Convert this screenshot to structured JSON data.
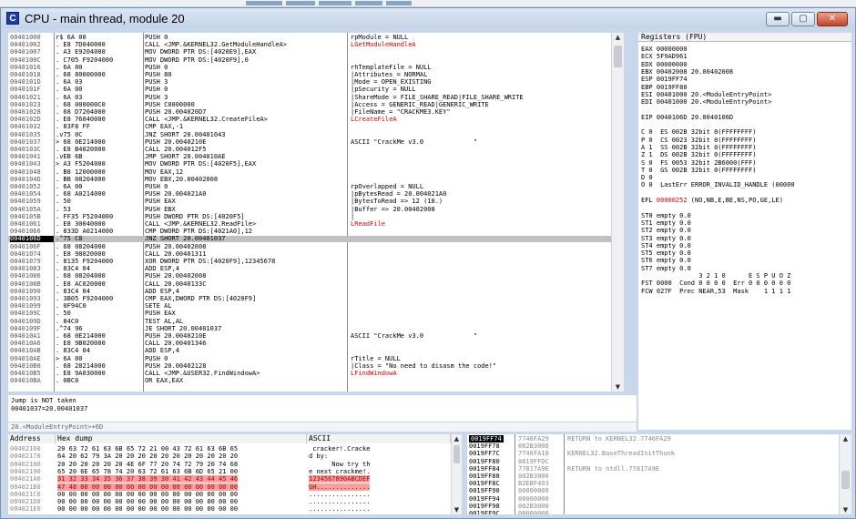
{
  "window": {
    "icon_letter": "C",
    "title": "CPU - main thread, module 20",
    "min_label": "▬",
    "max_label": "▢",
    "close_label": "✕"
  },
  "cpu": {
    "rows": [
      {
        "addr": "00401000",
        "hex": "r$ 6A 00",
        "dis": "PUSH 0",
        "cmt": "rpModule = NULL",
        "cmt_red": false
      },
      {
        "addr": "00401002",
        "hex": ". E8 7D040000",
        "dis": "CALL <JMP.&KERNEL32.GetModuleHandleA>",
        "cmt": "LGetModuleHandleA",
        "cmt_red": true
      },
      {
        "addr": "00401007",
        "hex": ". A3 E9204000",
        "dis": "MOV DWORD PTR DS:[4020E9],EAX",
        "cmt": "",
        "cmt_red": false
      },
      {
        "addr": "0040100C",
        "hex": ". C705 F9204000",
        "dis": "MOV DWORD PTR DS:[4020F9],0",
        "cmt": "",
        "cmt_red": false
      },
      {
        "addr": "00401016",
        "hex": ". 6A 00",
        "dis": "PUSH 0",
        "cmt": "rhTemplateFile = NULL",
        "cmt_red": false
      },
      {
        "addr": "00401018",
        "hex": ". 68 80000000",
        "dis": "PUSH 80",
        "cmt": "|Attributes = NORMAL",
        "cmt_red": false
      },
      {
        "addr": "0040101D",
        "hex": ". 6A 03",
        "dis": "PUSH 3",
        "cmt": "|Mode = OPEN_EXISTING",
        "cmt_red": false
      },
      {
        "addr": "0040101F",
        "hex": ". 6A 00",
        "dis": "PUSH 0",
        "cmt": "|pSecurity = NULL",
        "cmt_red": false
      },
      {
        "addr": "00401021",
        "hex": ". 6A 03",
        "dis": "PUSH 3",
        "cmt": "|ShareMode = FILE_SHARE_READ|FILE_SHARE_WRITE",
        "cmt_red": false
      },
      {
        "addr": "00401023",
        "hex": ". 68 000000C0",
        "dis": "PUSH C0000000",
        "cmt": "|Access = GENERIC_READ|GENERIC_WRITE",
        "cmt_red": false
      },
      {
        "addr": "00401028",
        "hex": ". 68 D7204000",
        "dis": "PUSH 20.004020D7",
        "cmt": "|FileName = \"CRACKME3.KEY\"",
        "cmt_red": false
      },
      {
        "addr": "0040102D",
        "hex": ". E8 76040000",
        "dis": "CALL <JMP.&KERNEL32.CreateFileA>",
        "cmt": "LCreateFileA",
        "cmt_red": true
      },
      {
        "addr": "00401032",
        "hex": ". 83F8 FF",
        "dis": "CMP EAX,-1",
        "cmt": "",
        "cmt_red": false
      },
      {
        "addr": "00401035",
        "hex": ".v75 0C",
        "dis": "JNZ SHORT 20.00401043",
        "cmt": "",
        "cmt_red": false
      },
      {
        "addr": "00401037",
        "hex": "> 68 0E214000",
        "dis": "PUSH 20.0040210E",
        "cmt": "ASCII \"CrackMe v3.0             \"",
        "cmt_red": false
      },
      {
        "addr": "0040103C",
        "hex": ". E8 B4020000",
        "dis": "CALL 20.004012F5",
        "cmt": "",
        "cmt_red": false
      },
      {
        "addr": "00401041",
        "hex": ".vEB 6B",
        "dis": "JMP SHORT 20.004010AE",
        "cmt": "",
        "cmt_red": false
      },
      {
        "addr": "00401043",
        "hex": "> A3 F5204000",
        "dis": "MOV DWORD PTR DS:[4020F5],EAX",
        "cmt": "",
        "cmt_red": false
      },
      {
        "addr": "00401048",
        "hex": ". B8 12000000",
        "dis": "MOV EAX,12",
        "cmt": "",
        "cmt_red": false
      },
      {
        "addr": "0040104D",
        "hex": ". BB 08204000",
        "dis": "MOV EBX,20.00402008",
        "cmt": "",
        "cmt_red": false
      },
      {
        "addr": "00401052",
        "hex": ". 6A 00",
        "dis": "PUSH 0",
        "cmt": "rpOverlapped = NULL",
        "cmt_red": false
      },
      {
        "addr": "00401054",
        "hex": ". 68 A0214000",
        "dis": "PUSH 20.004021A0",
        "cmt": "|pBytesRead = 20.004021A0",
        "cmt_red": false
      },
      {
        "addr": "00401059",
        "hex": ". 50",
        "dis": "PUSH EAX",
        "cmt": "|BytesToRead => 12 (18.)",
        "cmt_red": false
      },
      {
        "addr": "0040105A",
        "hex": ". 53",
        "dis": "PUSH EBX",
        "cmt": "|Buffer => 20.00402008",
        "cmt_red": false
      },
      {
        "addr": "0040105B",
        "hex": ". FF35 F5204000",
        "dis": "PUSH DWORD PTR DS:[4020F5]",
        "cmt": "|",
        "cmt_red": false
      },
      {
        "addr": "00401061",
        "hex": ". E8 30040000",
        "dis": "CALL <JMP.&KERNEL32.ReadFile>",
        "cmt": "LReadFile",
        "cmt_red": true
      },
      {
        "addr": "00401066",
        "hex": ". 833D A0214000",
        "dis": "CMP DWORD PTR DS:[4021A0],12",
        "cmt": "",
        "cmt_red": false
      },
      {
        "addr": "0040106D",
        "hex": ".^75 C8",
        "dis": "JNZ SHORT 20.00401037",
        "cmt": "",
        "cmt_red": false
      },
      {
        "addr": "0040106F",
        "hex": ". 68 08204000",
        "dis": "PUSH 20.00402008",
        "cmt": "",
        "cmt_red": false
      },
      {
        "addr": "00401074",
        "hex": ". E8 98020000",
        "dis": "CALL 20.00401311",
        "cmt": "",
        "cmt_red": false
      },
      {
        "addr": "00401079",
        "hex": ". 8135 F9204000",
        "dis": "XOR DWORD PTR DS:[4020F9],12345678",
        "cmt": "",
        "cmt_red": false
      },
      {
        "addr": "00401083",
        "hex": ". 83C4 04",
        "dis": "ADD ESP,4",
        "cmt": "",
        "cmt_red": false
      },
      {
        "addr": "00401086",
        "hex": ". 68 08204000",
        "dis": "PUSH 20.00402008",
        "cmt": "",
        "cmt_red": false
      },
      {
        "addr": "0040108B",
        "hex": ". E8 AC020000",
        "dis": "CALL 20.0040133C",
        "cmt": "",
        "cmt_red": false
      },
      {
        "addr": "00401090",
        "hex": ". 83C4 04",
        "dis": "ADD ESP,4",
        "cmt": "",
        "cmt_red": false
      },
      {
        "addr": "00401093",
        "hex": ". 3B05 F9204000",
        "dis": "CMP EAX,DWORD PTR DS:[4020F9]",
        "cmt": "",
        "cmt_red": false
      },
      {
        "addr": "00401099",
        "hex": ". 0F94C0",
        "dis": "SETE AL",
        "cmt": "",
        "cmt_red": false
      },
      {
        "addr": "0040109C",
        "hex": ". 50",
        "dis": "PUSH EAX",
        "cmt": "",
        "cmt_red": false
      },
      {
        "addr": "0040109D",
        "hex": ". 84C0",
        "dis": "TEST AL,AL",
        "cmt": "",
        "cmt_red": false
      },
      {
        "addr": "0040109F",
        "hex": ".^74 96",
        "dis": "JE SHORT 20.00401037",
        "cmt": "",
        "cmt_red": false
      },
      {
        "addr": "004010A1",
        "hex": ". 68 0E214000",
        "dis": "PUSH 20.0040210E",
        "cmt": "ASCII \"CrackMe v3.0             \"",
        "cmt_red": false
      },
      {
        "addr": "004010A6",
        "hex": ". E8 9B020000",
        "dis": "CALL 20.00401346",
        "cmt": "",
        "cmt_red": false
      },
      {
        "addr": "004010AB",
        "hex": ". 83C4 04",
        "dis": "ADD ESP,4",
        "cmt": "",
        "cmt_red": false
      },
      {
        "addr": "004010AE",
        "hex": "> 6A 00",
        "dis": "PUSH 0",
        "cmt": "rTitle = NULL",
        "cmt_red": false
      },
      {
        "addr": "004010B0",
        "hex": ". 68 28214000",
        "dis": "PUSH 20.00402128",
        "cmt": "|Class = \"No need to disasm the code!\"",
        "cmt_red": false
      },
      {
        "addr": "004010B5",
        "hex": ". E8 9A030000",
        "dis": "CALL <JMP.&USER32.FindWindowA>",
        "cmt": "LFindWindowA",
        "cmt_red": true
      },
      {
        "addr": "004010BA",
        "hex": ". 0BC0",
        "dis": "OR EAX,EAX",
        "cmt": "",
        "cmt_red": false
      }
    ],
    "selected_index": 27
  },
  "info": {
    "line1": "Jump is NOT taken",
    "line2": "00401037=20.00401037",
    "status": "20.<ModuleEntryPoint>+6D"
  },
  "registers": {
    "header": "Registers (FPU)",
    "lines": [
      "EAX 00000000",
      "ECX 5F9AD961",
      "EDX 00000000",
      "EBX 00402008 20.00402008",
      "ESP 0019FF74",
      "EBP 0019FF80",
      "ESI 00401000 20.<ModuleEntryPoint>",
      "EDI 00401000 20.<ModuleEntryPoint>",
      "",
      "EIP 0040106D 20.0040106D",
      "",
      "C 0  ES 002B 32bit 0(FFFFFFFF)",
      "P 0  CS 0023 32bit 0(FFFFFFFF)",
      "A 1  SS 002B 32bit 0(FFFFFFFF)",
      "Z 1  DS 002B 32bit 0(FFFFFFFF)",
      "S 0  FS 0053 32bit 2B6000(FFF)",
      "T 0  GS 002B 32bit 0(FFFFFFFF)",
      "D 0",
      "O 0  LastErr ERROR_INVALID_HANDLE (00000",
      "",
      "EFL 00000252 (NO,NB,E,BE,NS,PO,GE,LE)",
      "",
      "ST0 empty 0.0",
      "ST1 empty 0.0",
      "ST2 empty 0.0",
      "ST3 empty 0.0",
      "ST4 empty 0.0",
      "ST5 empty 0.0",
      "ST6 empty 0.0",
      "ST7 empty 0.0",
      "               3 2 1 0      E S P U O Z",
      "FST 0000  Cond 0 0 0 0  Err 0 0 0 0 0 0",
      "FCW 027F  Prec NEAR,53  Mask    1 1 1 1"
    ]
  },
  "dump": {
    "col_address": "Address",
    "col_hex": "Hex dump",
    "col_ascii": "ASCII",
    "rows": [
      {
        "addr": "00402160",
        "hex": "20 63 72 61 63 6B 65 72 21 00 43 72 61 63 6B 65",
        "ascii": " cracker!.Cracke",
        "hl": false
      },
      {
        "addr": "00402170",
        "hex": "64 20 62 79 3A 20 20 20 20 20 20 20 20 20 20 20",
        "ascii": "d by:           ",
        "hl": false
      },
      {
        "addr": "00402180",
        "hex": "20 20 20 20 20 20 4E 6F 77 20 74 72 79 20 74 68",
        "ascii": "      Now try th",
        "hl": false
      },
      {
        "addr": "00402190",
        "hex": "65 20 6E 65 78 74 20 63 72 61 63 6B 6D 65 21 00",
        "ascii": "e next crackme!.",
        "hl": false
      },
      {
        "addr": "004021A0",
        "hex": "31 32 33 34 35 36 37 38 39 30 41 42 43 44 45 46",
        "ascii": "1234567890ABCDEF",
        "hl": true
      },
      {
        "addr": "004021B0",
        "hex": "47 48 00 00 00 00 00 00 00 00 00 00 00 00 00 00",
        "ascii": "GH..............",
        "hl": true
      },
      {
        "addr": "004021C0",
        "hex": "00 00 00 00 00 00 00 00 00 00 00 00 00 00 00 00",
        "ascii": "................",
        "hl": false
      },
      {
        "addr": "004021D0",
        "hex": "00 00 00 00 00 00 00 00 00 00 00 00 00 00 00 00",
        "ascii": "................",
        "hl": false
      },
      {
        "addr": "004021E0",
        "hex": "00 00 00 00 00 00 00 00 00 00 00 00 00 00 00 00",
        "ascii": "................",
        "hl": false
      }
    ]
  },
  "stack": {
    "rows": [
      {
        "addr": "0019FF74",
        "val": "7746FA29",
        "cmt": "RETURN to KERNEL32.7746FA29",
        "sel": true
      },
      {
        "addr": "0019FF78",
        "val": "002B3000",
        "cmt": "",
        "sel": false
      },
      {
        "addr": "0019FF7C",
        "val": "7746FA10",
        "cmt": "KERNEL32.BaseThreadInitThunk",
        "sel": false
      },
      {
        "addr": "0019FF80",
        "val": "0019FFDC",
        "cmt": "",
        "sel": false
      },
      {
        "addr": "0019FF84",
        "val": "77817A9E",
        "cmt": "RETURN to ntdll.77817A9E",
        "sel": false
      },
      {
        "addr": "0019FF88",
        "val": "002B3000",
        "cmt": "",
        "sel": false
      },
      {
        "addr": "0019FF8C",
        "val": "B2EBF493",
        "cmt": "",
        "sel": false
      },
      {
        "addr": "0019FF90",
        "val": "00000000",
        "cmt": "",
        "sel": false
      },
      {
        "addr": "0019FF94",
        "val": "00000000",
        "cmt": "",
        "sel": false
      },
      {
        "addr": "0019FF98",
        "val": "002B3000",
        "cmt": "",
        "sel": false
      },
      {
        "addr": "0019FF9C",
        "val": "00000000",
        "cmt": "",
        "sel": false
      }
    ]
  }
}
